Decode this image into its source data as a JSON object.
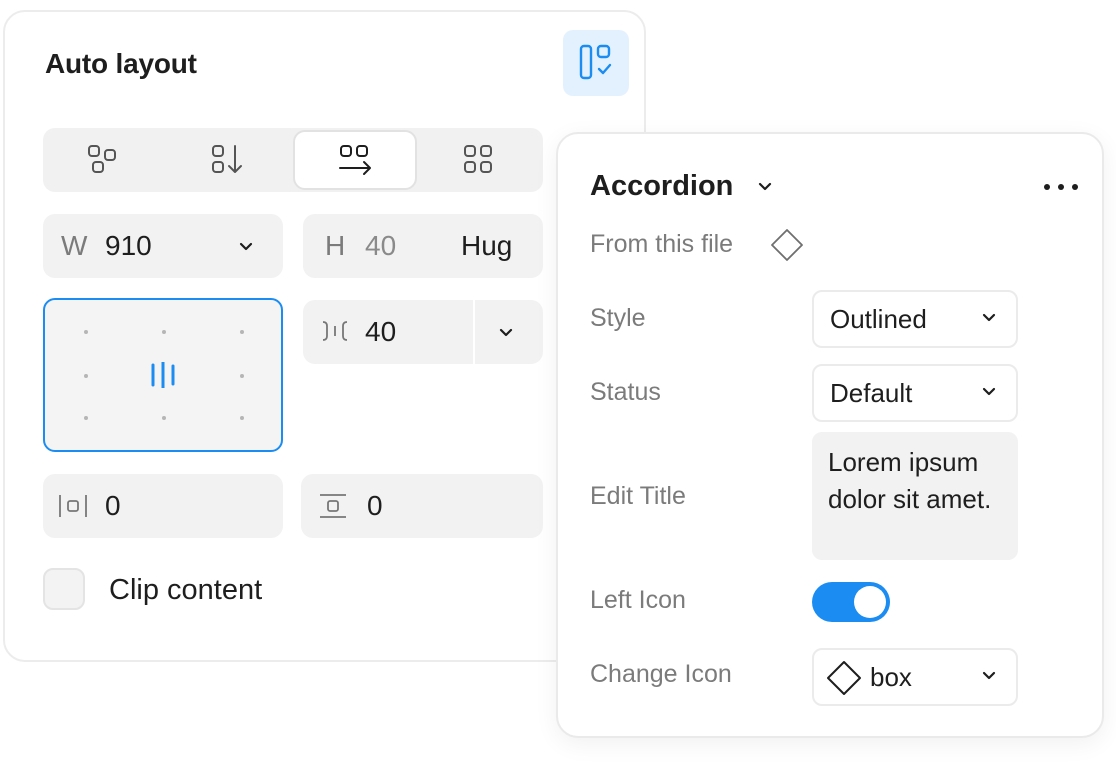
{
  "auto_layout": {
    "title": "Auto layout",
    "direction_options": [
      "free-layout-icon",
      "vertical-layout-icon",
      "horizontal-layout-icon",
      "grid-layout-icon"
    ],
    "selected_direction": "horizontal",
    "width": {
      "label": "W",
      "value": "910"
    },
    "height": {
      "label": "H",
      "value": "40",
      "mode": "Hug"
    },
    "gap": {
      "value": "40"
    },
    "padding_horizontal": {
      "value": "0"
    },
    "padding_vertical": {
      "value": "0"
    },
    "clip_content": {
      "label": "Clip content",
      "checked": false
    }
  },
  "component": {
    "name": "Accordion",
    "source": "From this file",
    "properties": {
      "style": {
        "label": "Style",
        "value": "Outlined"
      },
      "status": {
        "label": "Status",
        "value": "Default"
      },
      "edit_title": {
        "label": "Edit Title",
        "value": "Lorem ipsum dolor sit amet."
      },
      "left_icon": {
        "label": "Left Icon",
        "enabled": true
      },
      "change_icon": {
        "label": "Change Icon",
        "value": "box"
      }
    }
  },
  "colors": {
    "accent": "#1b8cf2",
    "accent_light": "#e3f1ff",
    "field_bg": "#f2f2f2",
    "label_gray": "#7b7b7b"
  }
}
